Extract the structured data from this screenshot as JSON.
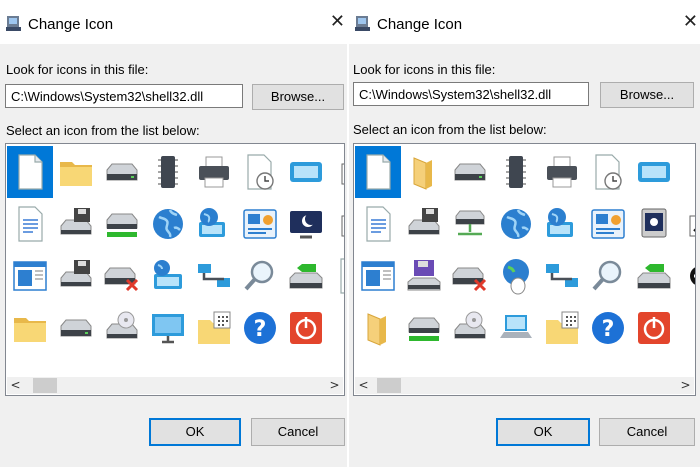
{
  "dialogs": [
    {
      "style": "win10",
      "title": "Change Icon",
      "close_glyph": "✕",
      "look_label": "Look for icons in this file:",
      "path_value": "C:\\Windows\\System32\\shell32.dll",
      "browse_label": "Browse...",
      "select_label": "Select an icon from the list below:",
      "ok_label": "OK",
      "cancel_label": "Cancel",
      "scroll_left": "<",
      "scroll_right": ">",
      "icons": [
        [
          "blank-document-icon",
          "folder-icon",
          "drive-icon",
          "memory-chip-icon",
          "printer-icon",
          "document-clock-icon",
          "display-icon",
          "shortcut-arrow-icon"
        ],
        [
          "text-document-icon",
          "floppy-drive-icon",
          "removable-drive-icon",
          "globe-icon",
          "network-globe-icon",
          "control-panel-icon",
          "monitor-moon-icon",
          "shortcut-arrow-icon"
        ],
        [
          "window-app-icon",
          "drive-floppy-icon",
          "drive-error-icon",
          "world-computer-icon",
          "network-icon",
          "search-icon",
          "recycle-arrow-icon",
          "blank-partial-icon"
        ],
        [
          "folder-icon",
          "drive-icon",
          "cd-drive-icon",
          "monitor-icon",
          "folder-grid-icon",
          "help-icon",
          "shutdown-icon",
          "partial-icon"
        ]
      ]
    },
    {
      "style": "classic",
      "title": "Change Icon",
      "close_glyph": "✕",
      "look_label": "Look for icons in this file:",
      "path_value": "C:\\Windows\\System32\\shell32.dll",
      "browse_label": "Browse...",
      "select_label": "Select an icon from the list below:",
      "ok_label": "OK",
      "cancel_label": "Cancel",
      "scroll_left": "<",
      "scroll_right": ">",
      "icons": [
        [
          "blank-document-icon",
          "open-folder-icon",
          "drive-icon",
          "memory-chip-icon",
          "printer-icon",
          "document-clock-icon",
          "display-icon",
          "partial-icon"
        ],
        [
          "text-document-icon",
          "floppy-drive-icon",
          "network-drive-icon",
          "internet-explorer-icon",
          "network-globe-icon",
          "control-panel-icon",
          "screensaver-icon",
          "shortcut-arrow-icon"
        ],
        [
          "window-app-icon",
          "floppy-disk-drive-icon",
          "drive-error-icon",
          "world-mouse-icon",
          "network-icon",
          "search-icon",
          "recycle-arrow-icon",
          "no-entry-icon"
        ],
        [
          "open-folder-icon",
          "removable-drive-icon",
          "cd-drive-icon",
          "laptop-icon",
          "folder-grid-icon",
          "help-icon",
          "shutdown-icon",
          "partial-icon"
        ]
      ]
    }
  ]
}
